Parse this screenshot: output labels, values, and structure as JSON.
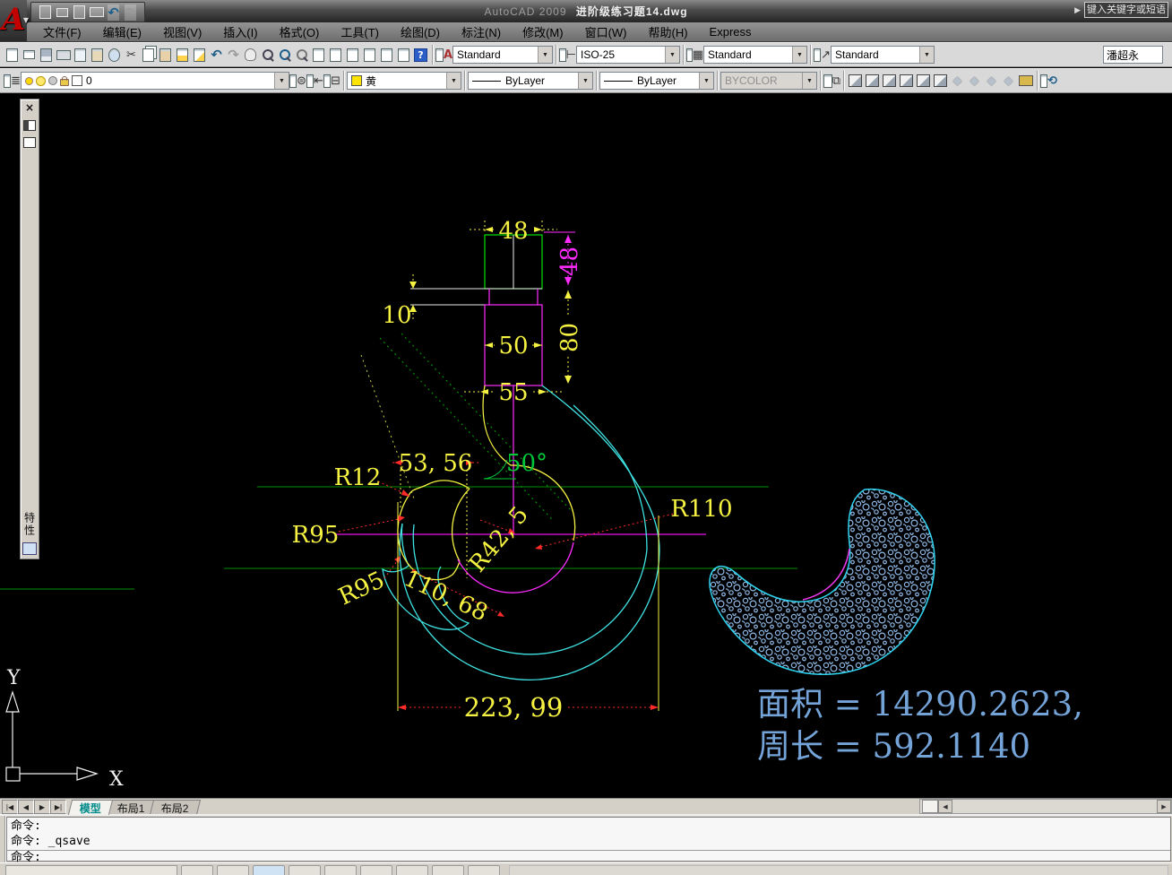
{
  "title_bar": {
    "app_name": "AutoCAD 2009",
    "doc_name": "进阶级练习题14.dwg",
    "info_arrow": "▶",
    "search_placeholder": "键入关键字或短语"
  },
  "quick_access": {
    "icons": [
      "new-file",
      "open",
      "save",
      "print",
      "undo",
      "redo"
    ]
  },
  "menu_bar": {
    "items": [
      "文件(F)",
      "编辑(E)",
      "视图(V)",
      "插入(I)",
      "格式(O)",
      "工具(T)",
      "绘图(D)",
      "标注(N)",
      "修改(M)",
      "窗口(W)",
      "帮助(H)",
      "Express"
    ]
  },
  "standard_toolbar": {
    "icons": [
      "new-file",
      "open",
      "save",
      "print",
      "plot-preview",
      "publish",
      "plot",
      "cut",
      "copy",
      "paste",
      "match-properties",
      "block-editor",
      "undo",
      "redo",
      "pan",
      "zoom-realtime",
      "zoom-window",
      "zoom-previous",
      "properties",
      "designcenter",
      "tool-palettes",
      "sheetset-manager",
      "markup",
      "quickcalc",
      "help"
    ]
  },
  "styles_toolbar": {
    "text_style_label": "Standard",
    "dim_style_label": "ISO-25",
    "table_style_label": "Standard",
    "mleader_style_label": "Standard",
    "user_text": "潘超永",
    "dropdown_glyph": "▼"
  },
  "layers_toolbar": {
    "layer_name": "0",
    "color_name": "黄",
    "linetype": "ByLayer",
    "lineweight": "ByLayer",
    "plot_style": "BYCOLOR",
    "dropdown_glyph": "▼"
  },
  "view_toolbar": {
    "icons": [
      "view-top",
      "view-bottom",
      "view-left",
      "view-right",
      "view-front",
      "view-back",
      "sw-isometric",
      "se-isometric",
      "ne-isometric",
      "nw-isometric",
      "camera"
    ]
  },
  "palette": {
    "close_glyph": "×",
    "title": "特性"
  },
  "drawing": {
    "dims": {
      "top_width": "48",
      "right_upper": "48",
      "band": "10",
      "mid_width": "50",
      "lower_width": "55",
      "right_lower": "80",
      "coord_53_56": "53, 56",
      "angle": "50°",
      "r12": "R12",
      "r95_a": "R95",
      "r95_b": "R95",
      "r42_5": "R42, 5",
      "d110_68": "110, 68",
      "r110": "R110",
      "overall": "223, 99"
    },
    "result": {
      "line1": "面积 = 14290.2623,",
      "line2": "周长 = 592.1140"
    },
    "ucs": {
      "x": "X",
      "y": "Y"
    }
  },
  "layout_tabs": {
    "nav_glyphs": [
      "|◀",
      "◀",
      "▶",
      "▶|"
    ],
    "model": "模型",
    "layout1": "布局1",
    "layout2": "布局2"
  },
  "command_line": {
    "history_line1": "命令:",
    "history_line2": "命令: _qsave",
    "prompt": "命令:"
  },
  "colors": {
    "canvas": "#000000",
    "dim_yellow": "#f5f242",
    "magenta": "#ff2bff",
    "cyan": "#3fe3e3",
    "bright_green": "#00c838",
    "dark_green": "#009000",
    "leader_red": "#ff2a2a",
    "hatch_blue": "#8fb9e6",
    "result_text": "#74a3d8",
    "model_tab_text": "#008b8b"
  }
}
